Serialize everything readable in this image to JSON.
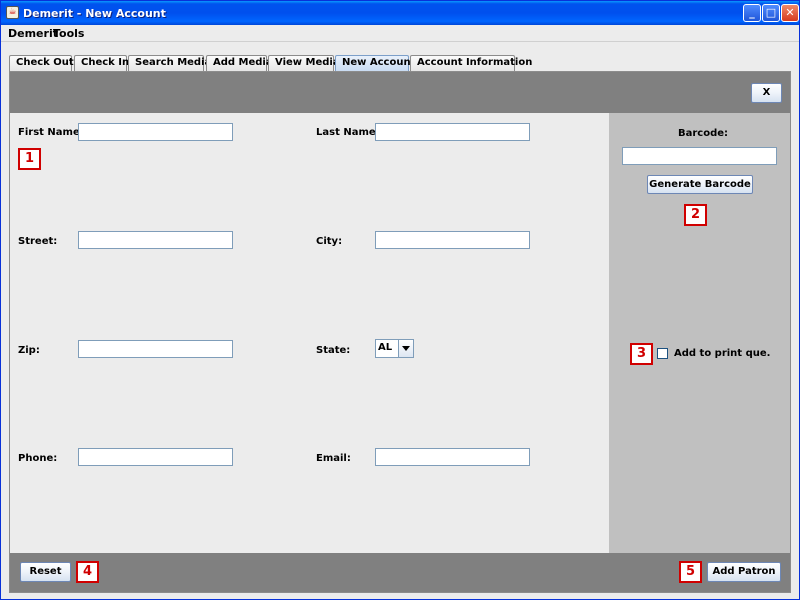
{
  "window": {
    "title": "Demerit - New Account",
    "icon": "java-cup-icon",
    "controls": [
      "_",
      "□",
      "✕"
    ]
  },
  "menu": [
    "Demerit",
    "Tools"
  ],
  "tabs": [
    {
      "label": "Check Out",
      "active": false
    },
    {
      "label": "Check In",
      "active": false
    },
    {
      "label": "Search Media",
      "active": false
    },
    {
      "label": "Add Media",
      "active": false
    },
    {
      "label": "View Media",
      "active": false
    },
    {
      "label": "New Account",
      "active": true
    },
    {
      "label": "Account Information",
      "active": false
    }
  ],
  "close_button": "X",
  "form": {
    "first_name": {
      "label": "First Name:",
      "value": ""
    },
    "last_name": {
      "label": "Last Name:",
      "value": ""
    },
    "street": {
      "label": "Street:",
      "value": ""
    },
    "city": {
      "label": "City:",
      "value": ""
    },
    "zip": {
      "label": "Zip:",
      "value": ""
    },
    "state": {
      "label": "State:",
      "value": "AL"
    },
    "phone": {
      "label": "Phone:",
      "value": ""
    },
    "email": {
      "label": "Email:",
      "value": ""
    }
  },
  "side": {
    "barcode_label": "Barcode:",
    "barcode_value": "",
    "generate_button": "Generate Barcode",
    "print_queue_label": "Add to print que.",
    "print_queue_checked": false
  },
  "footer": {
    "reset_button": "Reset",
    "add_patron_button": "Add Patron"
  },
  "markers": [
    "1",
    "2",
    "3",
    "4",
    "5"
  ],
  "colors": {
    "marker": "#d00000",
    "bar": "#808080",
    "side": "#c0c0c0"
  }
}
